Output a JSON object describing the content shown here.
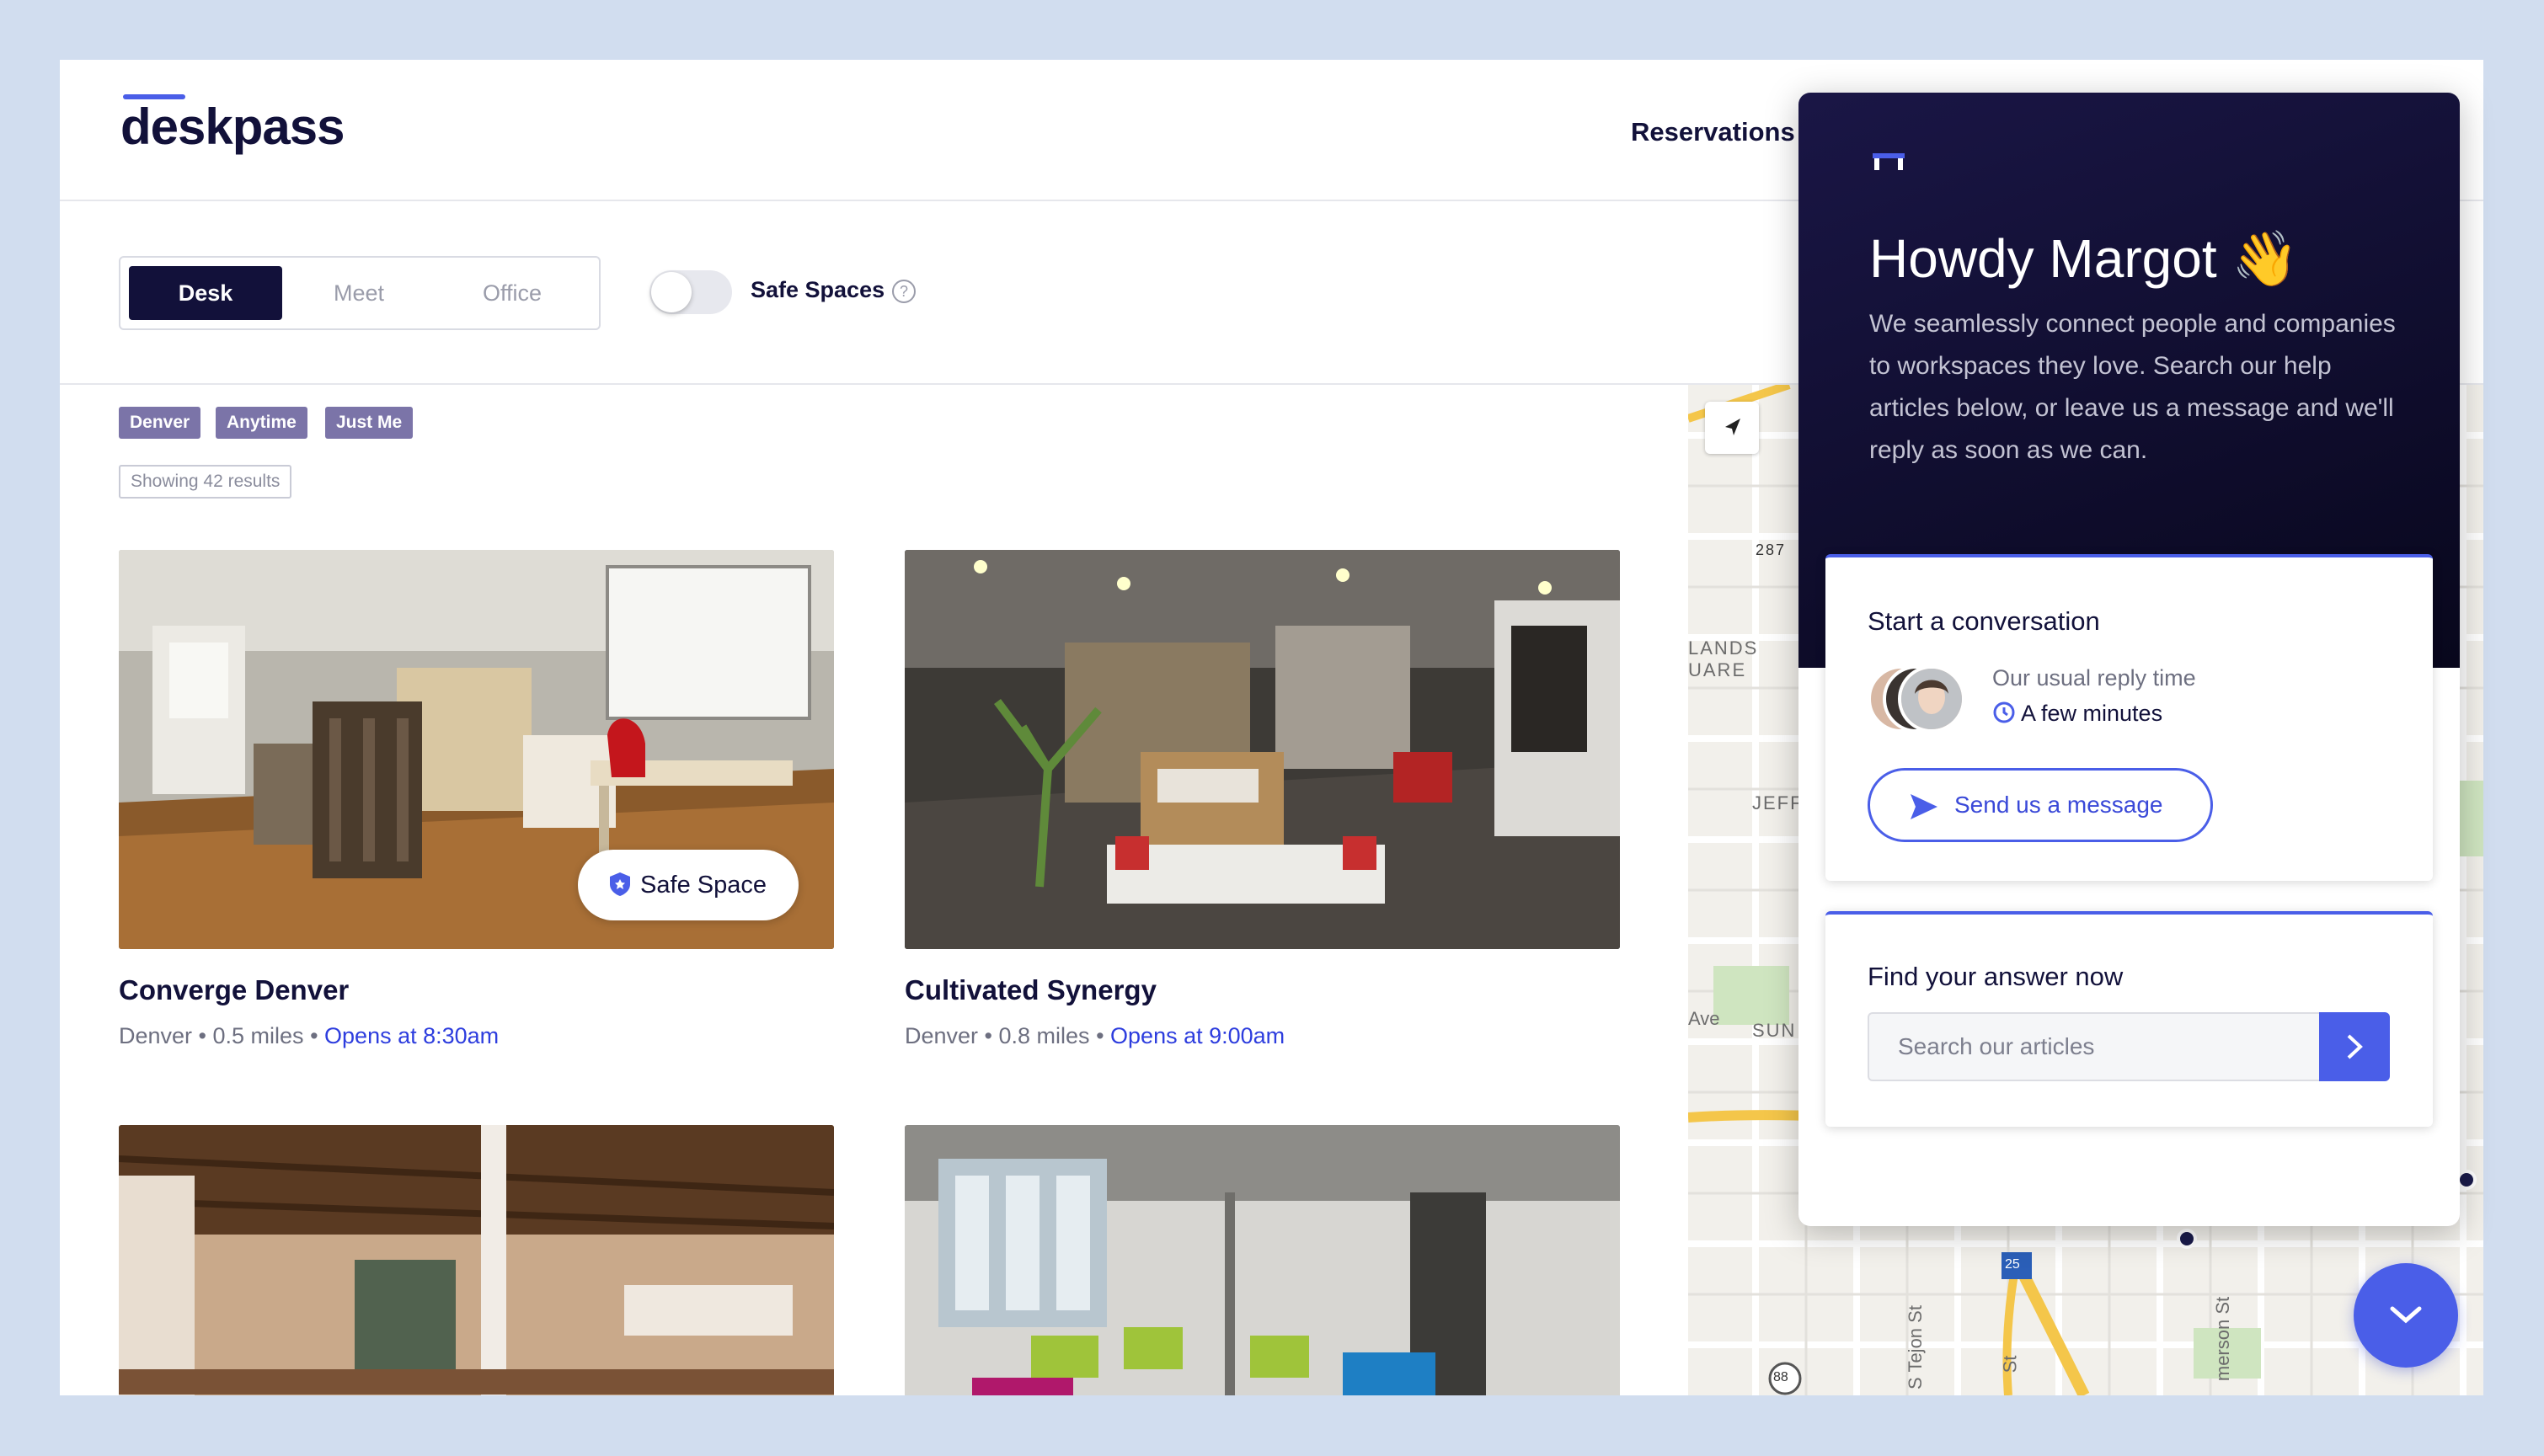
{
  "brand": {
    "logo_text": "deskpass",
    "accent": "#4a5ee8",
    "navy": "#12113a"
  },
  "header": {
    "nav_reservations": "Reservations"
  },
  "toolbar": {
    "tabs": [
      {
        "label": "Desk",
        "active": true
      },
      {
        "label": "Meet",
        "active": false
      },
      {
        "label": "Office",
        "active": false
      }
    ],
    "safe_spaces_label": "Safe Spaces",
    "safe_spaces_on": false,
    "help_glyph": "?"
  },
  "filters": {
    "chips": [
      "Denver",
      "Anytime",
      "Just Me"
    ],
    "results_text": "Showing 42 results"
  },
  "listings": [
    {
      "name": "Converge Denver",
      "city": "Denver",
      "distance": "0.5 miles",
      "opens": "Opens at 8:30am",
      "badge": "Safe Space"
    },
    {
      "name": "Cultivated Synergy",
      "city": "Denver",
      "distance": "0.8 miles",
      "opens": "Opens at 9:00am",
      "badge": ""
    },
    {
      "name": "",
      "city": "",
      "distance": "",
      "opens": "",
      "badge": ""
    },
    {
      "name": "",
      "city": "",
      "distance": "",
      "opens": "",
      "badge": ""
    }
  ],
  "map": {
    "labels": [
      "287",
      "LANDS",
      "UARE",
      "JEFF",
      "SUN",
      "25",
      "88",
      "S Tejon St",
      "merson St",
      "Ave",
      "St"
    ],
    "locate_icon": "navigation-arrow-icon"
  },
  "help_widget": {
    "greeting": "Howdy Margot 👋",
    "intro": "We seamlessly connect people and companies to workspaces they love. Search our help articles below, or leave us a message and we'll reply as soon as we can.",
    "conversation": {
      "title": "Start a conversation",
      "reply_label": "Our usual reply time",
      "reply_value": "A few minutes",
      "send_label": "Send us a message"
    },
    "find": {
      "title": "Find your answer now",
      "search_placeholder": "Search our articles"
    }
  }
}
